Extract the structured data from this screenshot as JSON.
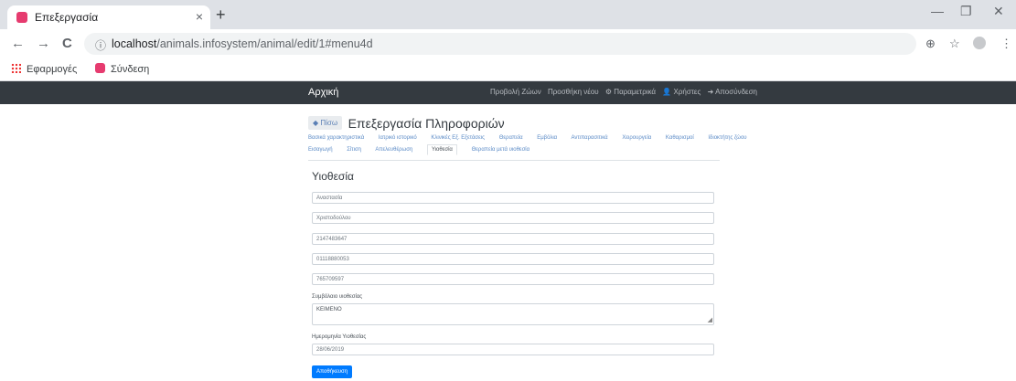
{
  "browser": {
    "tab_title": "Επεξεργασία",
    "tab_close": "×",
    "new_tab": "+",
    "window_controls": [
      "—",
      "❐",
      "✕"
    ],
    "nav": {
      "back": "←",
      "forward": "→",
      "reload": "C"
    },
    "url_info": "ⓘ",
    "url_host": "localhost",
    "url_path": "/animals.infosystem/animal/edit/1#menu4d",
    "toolbar_icons": {
      "zoom": "⊕",
      "star": "☆",
      "menu": "⋮"
    },
    "bookmarks": [
      "Εφαρμογές",
      "Σύνδεση"
    ]
  },
  "navbar": {
    "brand": "Αρχική",
    "links": [
      "Προβολή Ζώων",
      "Προσθήκη νέου",
      "⚙ Παραμετρικά",
      "👤 Χρήστες",
      "➜ Αποσύνδεση"
    ]
  },
  "page": {
    "back_label": "◆ Πίσω",
    "title": "Επεξεργασία Πληροφοριών",
    "tabs_row1": [
      "Βασικά χαρακτηριστικά",
      "Ιατρικό ιστορικό",
      "Κλινικές Εξ. Εξετάσεις",
      "Θεραπεία",
      "Εμβόλια",
      "Αντιπαρασιτικά",
      "Χειρουργεία",
      "Καθαρισμοί",
      "Ιδιοκτήτης ζώου"
    ],
    "tabs_row2": [
      "Εισαγωγή",
      "Σίτιση",
      "Απελευθέρωση",
      "Υιοθεσία",
      "Θεραπεία μετά υιοθεσία"
    ],
    "active_tab": "Υιοθεσία",
    "section_title": "Υιοθεσία",
    "fields": [
      "Αναστασία",
      "Χριστοδούλου",
      "2147483647",
      "01118880053",
      "765709597"
    ],
    "contract_label": "Συμβόλαιο υιοθεσίας",
    "contract_text": "ΚΕΙΜΕΝΟ",
    "date_label": "Ημερομηνία Υιοθεσίας",
    "date_value": "28/06/2019",
    "save_label": "Αποθήκευση"
  },
  "colors": {
    "navbar": "#343a40",
    "primary": "#007bff",
    "favicon": "#e63b6f"
  }
}
